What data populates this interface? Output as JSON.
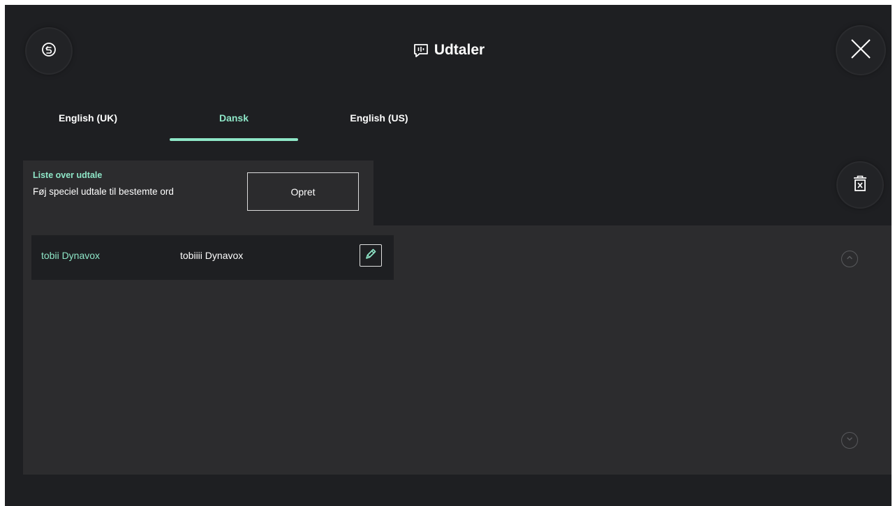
{
  "header": {
    "title": "Udtaler",
    "back_icon": "back-arrow-circle-icon",
    "title_icon": "speech-bubble-icon",
    "close_icon": "close-x-icon"
  },
  "tabs": [
    {
      "label": "English (UK)",
      "active": false
    },
    {
      "label": "Dansk",
      "active": true
    },
    {
      "label": "English (US)",
      "active": false
    }
  ],
  "list": {
    "heading": "Liste over udtale",
    "description": "Føj speciel udtale til bestemte ord",
    "create_label": "Opret",
    "delete_icon": "trash-icon",
    "entries": [
      {
        "word": "tobii Dynavox",
        "pronunciation": "tobiiii Dynavox",
        "edit_icon": "pencil-icon"
      }
    ],
    "scroll_up_icon": "chevron-up-icon",
    "scroll_down_icon": "chevron-down-icon"
  },
  "colors": {
    "background": "#1e1f22",
    "panel": "#2c2c2e",
    "accent": "#8ee6c7",
    "text": "#ffffff"
  }
}
